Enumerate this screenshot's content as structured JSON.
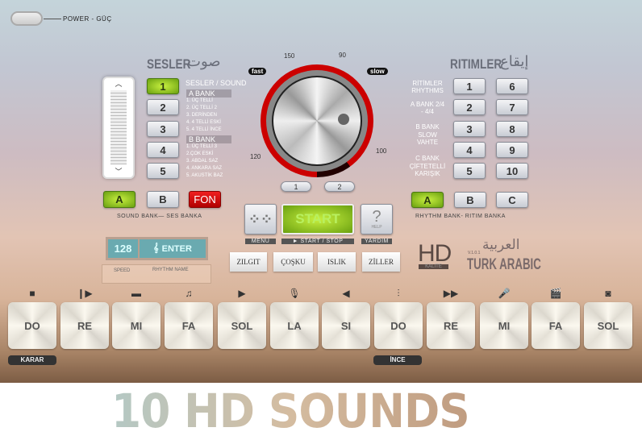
{
  "power": {
    "label": "POWER - GÜÇ"
  },
  "sounds": {
    "title": "SESLER",
    "title_ar": "صوت",
    "header": "SESLER / SOUND",
    "buttons": [
      "1",
      "2",
      "3",
      "4",
      "5"
    ],
    "active": "1",
    "bank_a": {
      "label": "A BANK",
      "items": [
        "1. ÜÇ TELLİ",
        "2. ÜÇ TELLİ 2",
        "3. DERİNDEN",
        "4. 4 TELLİ ESKİ",
        "5. 4 TELLİ İNCE"
      ]
    },
    "bank_b": {
      "label": "B BANK",
      "items": [
        "1. ÜÇ TELLİ 3",
        "2.ÇOK ESKİ",
        "3. ABDAL SAZ",
        "4. ANKARA SAZ",
        "5. AKUSTİK BAZ"
      ]
    },
    "bank_buttons": {
      "a": "A",
      "b": "B",
      "fon": "FON"
    },
    "bank_caption": "SOUND BANK— SES  BANKA"
  },
  "dial": {
    "fast": "fast",
    "slow": "slow",
    "ticks": [
      "150",
      "90",
      "120",
      "100"
    ],
    "buttons": [
      "1",
      "2"
    ]
  },
  "rhythms": {
    "title": "RITIMLER",
    "title_ar": "إيقاع",
    "labels": [
      "RİTİMLER RHYTHMS",
      "A BANK 2/4 - 4/4",
      "B BANK",
      "SLOW VAHTE",
      "C BANK",
      "ÇİFTETELLİ KARIŞIK"
    ],
    "buttons": [
      "1",
      "2",
      "3",
      "4",
      "5",
      "6",
      "7",
      "8",
      "9",
      "10"
    ],
    "bank_buttons": [
      "A",
      "B",
      "C"
    ],
    "bank_caption": "RHYTHM BANK- RITIM BANKA"
  },
  "controls": {
    "menu": "MENU",
    "start": "START",
    "start_caption": "► START / STOP",
    "help_icon": "?",
    "help": "HELP",
    "help_caption": "YARDIM"
  },
  "display": {
    "speed_value": "128",
    "enter": "ENTER",
    "speed_label": "SPEED",
    "rhythm_name_label": "RHYTHM NAME"
  },
  "effects": [
    "ZILGIT",
    "ÇOŞKU",
    "ISLIK",
    "ZİLLER"
  ],
  "brand": {
    "hd": "HD",
    "quality": "KALITE",
    "arabic": "العربية",
    "version": "V.1.0.1",
    "name": "TURK ARABIC"
  },
  "keys": [
    {
      "label": "DO",
      "icon": "stop-icon",
      "glyph": "■"
    },
    {
      "label": "RE",
      "icon": "play-step-icon",
      "glyph": "❙▶"
    },
    {
      "label": "MI",
      "icon": "radio-icon",
      "glyph": "▬"
    },
    {
      "label": "FA",
      "icon": "music-note-icon",
      "glyph": "♫"
    },
    {
      "label": "SOL",
      "icon": "play-icon",
      "glyph": "▶"
    },
    {
      "label": "LA",
      "icon": "microphone-icon",
      "glyph": "🎙"
    },
    {
      "label": "SI",
      "icon": "speaker-icon",
      "glyph": "◀"
    },
    {
      "label": "DO",
      "icon": "equalizer-icon",
      "glyph": "⫶"
    },
    {
      "label": "RE",
      "icon": "fast-forward-icon",
      "glyph": "▶▶"
    },
    {
      "label": "MI",
      "icon": "handheld-mic-icon",
      "glyph": "🎤"
    },
    {
      "label": "FA",
      "icon": "clapperboard-icon",
      "glyph": "🎬"
    },
    {
      "label": "SOL",
      "icon": "loudspeaker-icon",
      "glyph": "◙"
    }
  ],
  "key_captions": {
    "karar": "KARAR",
    "ince": "İNCE"
  },
  "banner": "10 HD SOUNDS"
}
